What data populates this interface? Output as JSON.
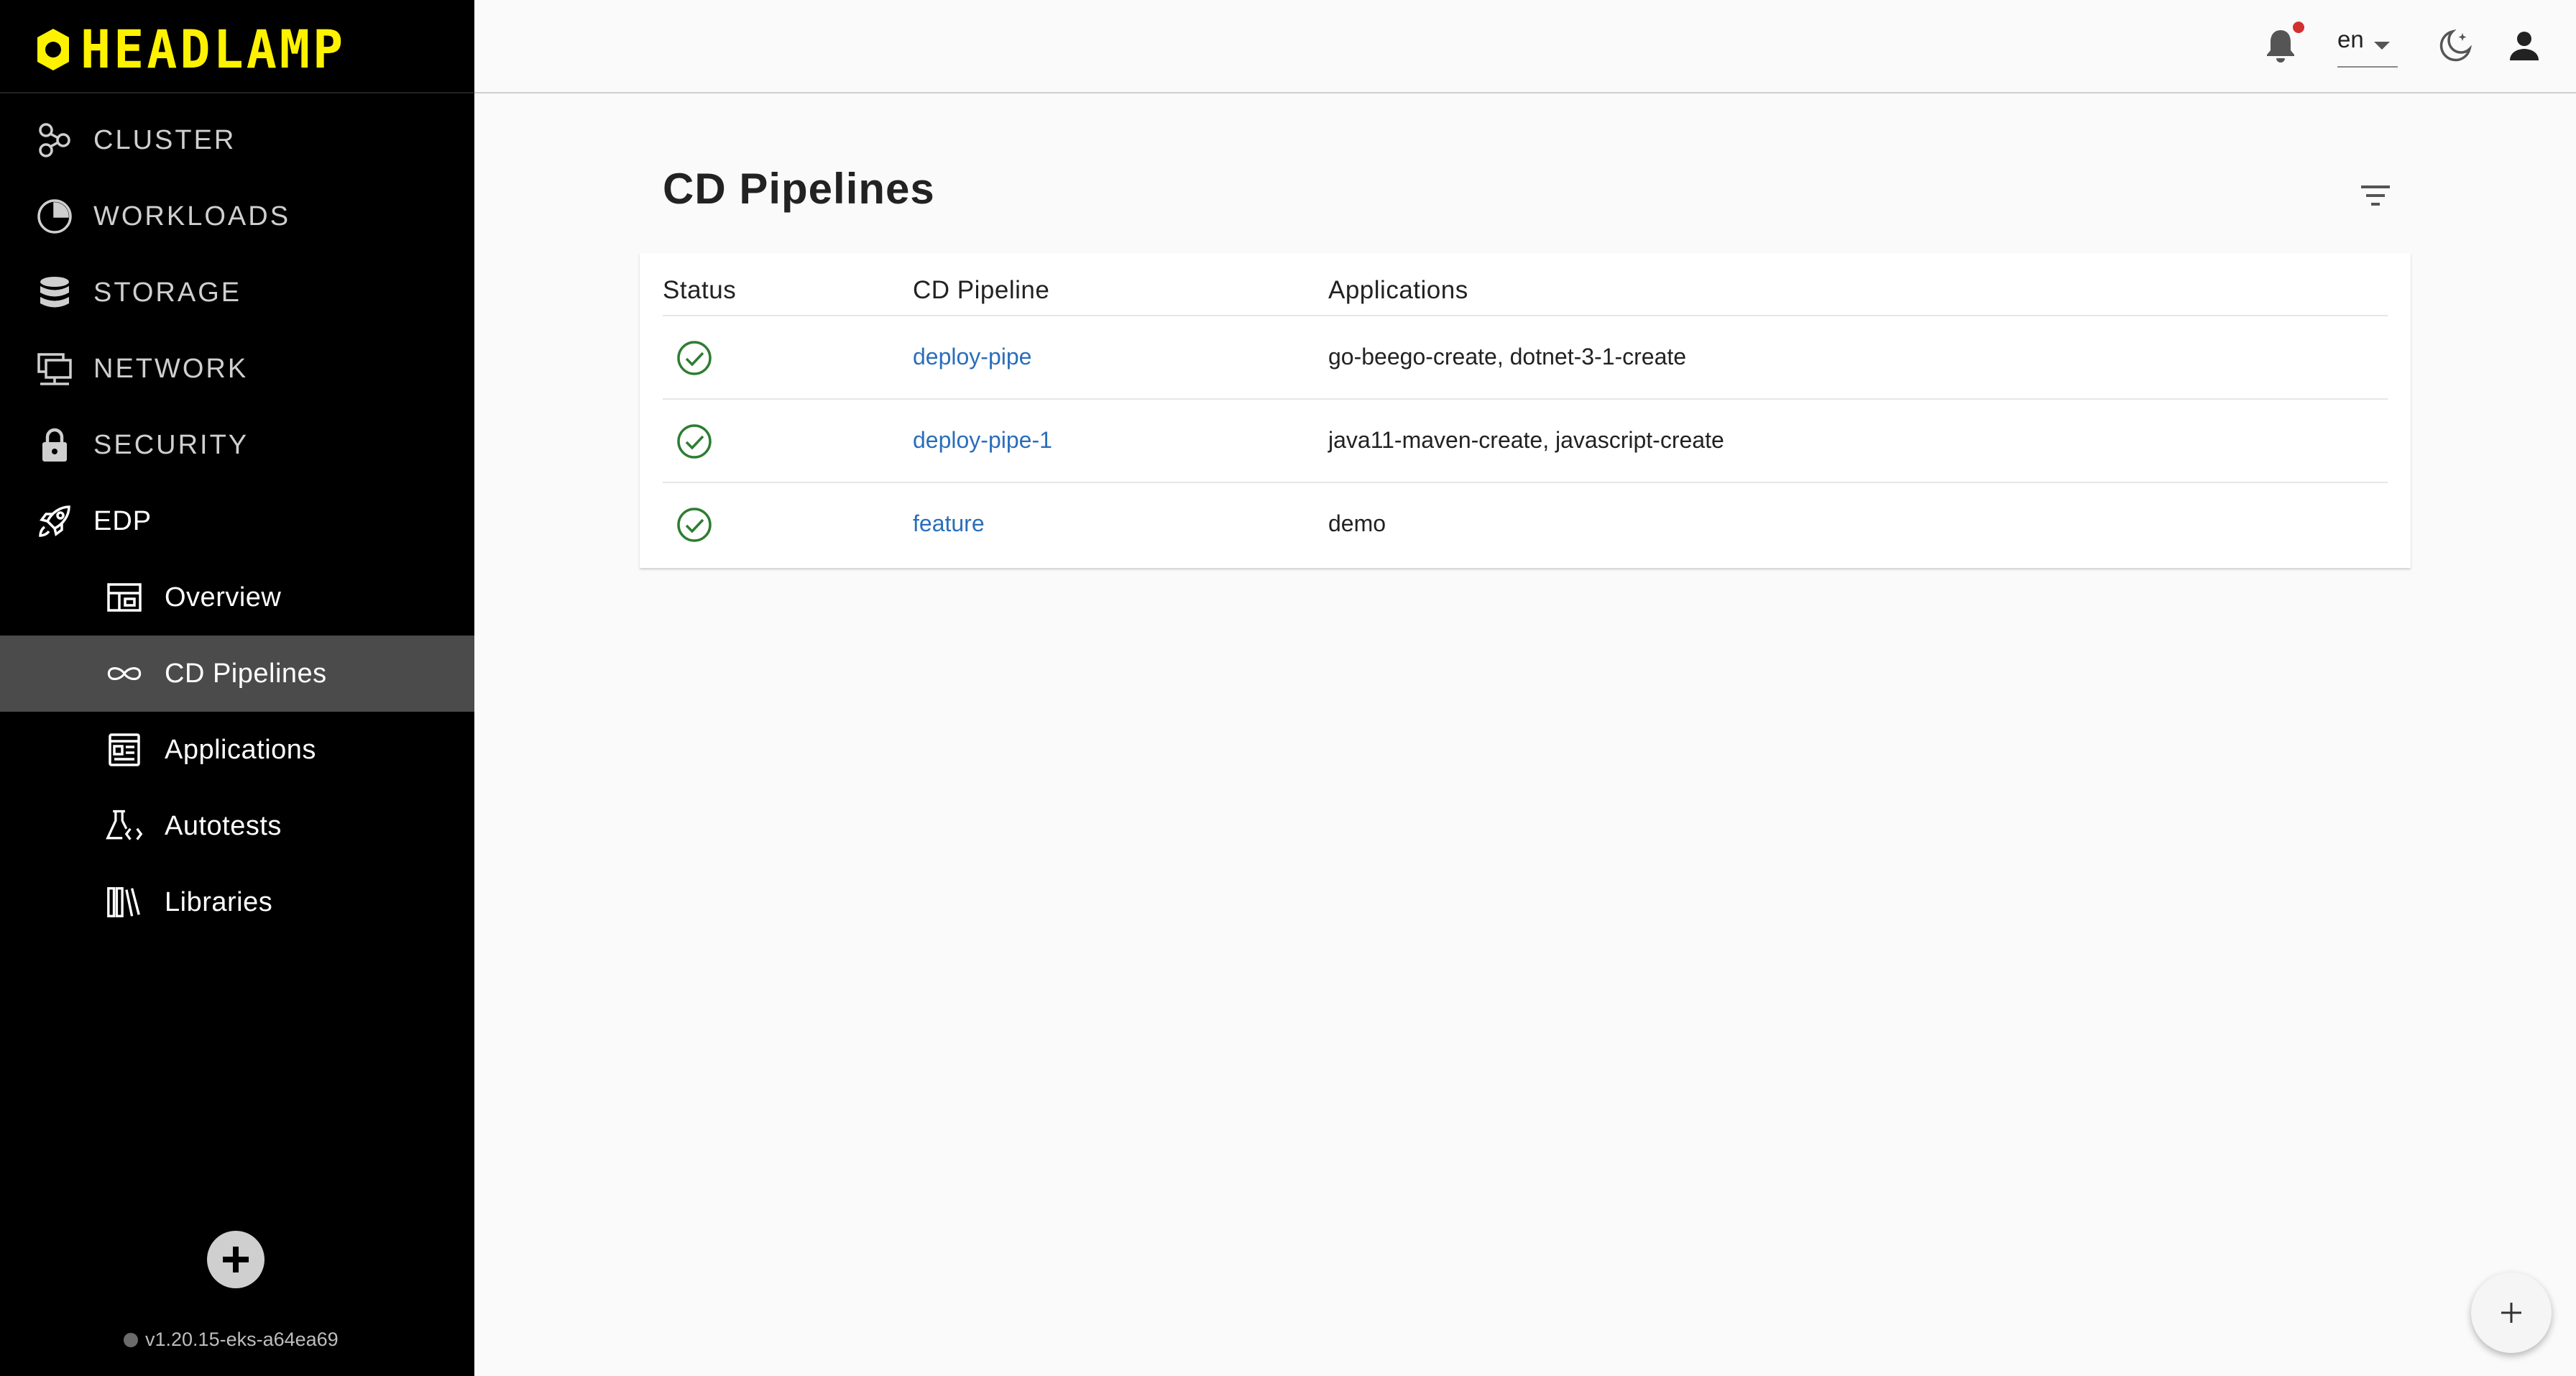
{
  "app": {
    "logo_text": "HEADLAMP"
  },
  "sidebar": {
    "items": [
      {
        "label": "CLUSTER",
        "icon": "cluster-icon"
      },
      {
        "label": "WORKLOADS",
        "icon": "workloads-icon"
      },
      {
        "label": "STORAGE",
        "icon": "storage-icon"
      },
      {
        "label": "NETWORK",
        "icon": "network-icon"
      },
      {
        "label": "SECURITY",
        "icon": "lock-icon"
      },
      {
        "label": "EDP",
        "icon": "rocket-icon"
      }
    ],
    "subitems": [
      {
        "label": "Overview",
        "icon": "overview-icon",
        "active": false
      },
      {
        "label": "CD Pipelines",
        "icon": "infinity-icon",
        "active": true
      },
      {
        "label": "Applications",
        "icon": "applications-icon",
        "active": false
      },
      {
        "label": "Autotests",
        "icon": "autotests-icon",
        "active": false
      },
      {
        "label": "Libraries",
        "icon": "libraries-icon",
        "active": false
      }
    ],
    "version": "v1.20.15-eks-a64ea69"
  },
  "topbar": {
    "language": "en"
  },
  "main": {
    "title": "CD Pipelines",
    "table": {
      "headers": [
        "Status",
        "CD Pipeline",
        "Applications"
      ],
      "rows": [
        {
          "status": "success",
          "pipeline": "deploy-pipe",
          "applications": "go-beego-create, dotnet-3-1-create"
        },
        {
          "status": "success",
          "pipeline": "deploy-pipe-1",
          "applications": "java11-maven-create, javascript-create"
        },
        {
          "status": "success",
          "pipeline": "feature",
          "applications": "demo"
        }
      ]
    }
  },
  "colors": {
    "sidebar_bg": "#000000",
    "logo": "#fff200",
    "active_item": "#4b4b4b",
    "link": "#2a6ebb",
    "success": "#2e7d32",
    "notification_dot": "#d32f2f"
  }
}
